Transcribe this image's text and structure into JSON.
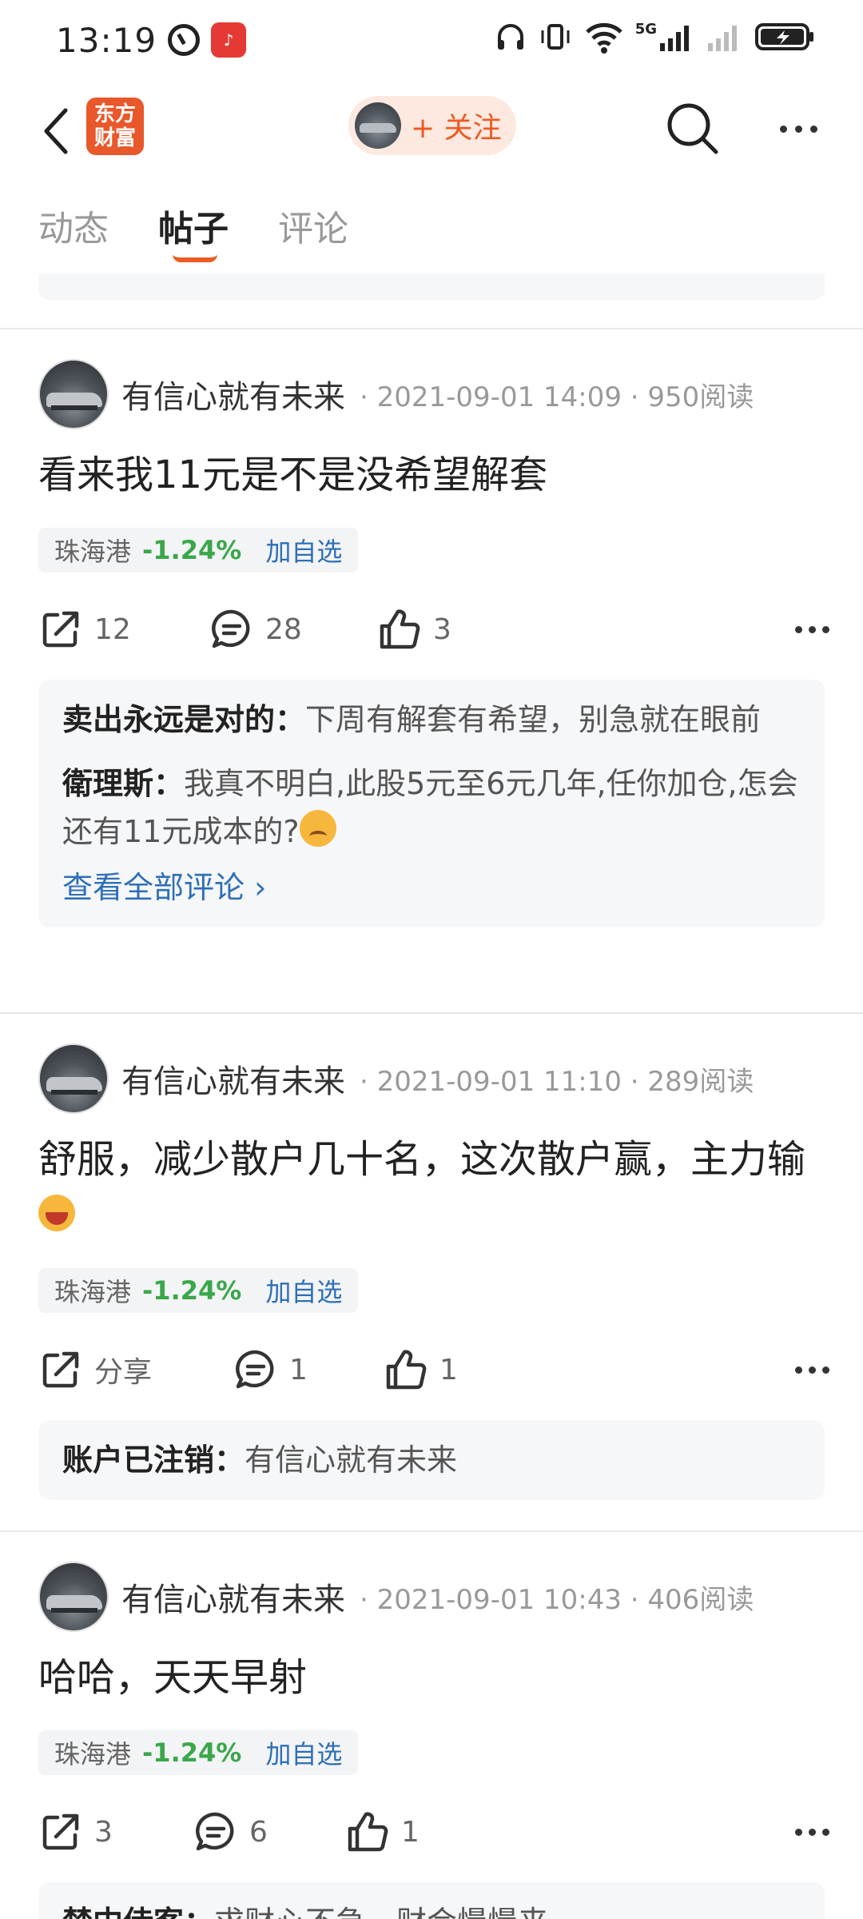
{
  "status_bar": {
    "time": "13:19",
    "signal_label": "5G",
    "wifi_label": "6"
  },
  "header": {
    "logo_text_line1": "东方",
    "logo_text_line2": "财富",
    "follow_label": "+ 关注"
  },
  "tabs": [
    {
      "label": "动态",
      "active": false
    },
    {
      "label": "帖子",
      "active": true
    },
    {
      "label": "评论",
      "active": false
    }
  ],
  "colors": {
    "accent": "#ee5a24",
    "stock_down": "#3aa74a",
    "link": "#2f6fb6"
  },
  "posts": [
    {
      "author": "有信心就有未来",
      "meta": "· 2021-09-01 14:09 · 950阅读",
      "title": "看来我11元是不是没希望解套",
      "stock": {
        "name": "珠海港",
        "change": "-1.24%",
        "add_label": "加自选"
      },
      "actions": {
        "share": "12",
        "comment": "28",
        "like": "3"
      },
      "comments": [
        {
          "user": "卖出永远是对的：",
          "text": "下周有解套有希望，别急就在眼前"
        },
        {
          "user": "衛理斯：",
          "text": "我真不明白,此股5元至6元几年,任你加仓,怎会还有11元成本的?"
        }
      ],
      "view_all": "查看全部评论 ›"
    },
    {
      "author": "有信心就有未来",
      "meta": "· 2021-09-01 11:10 · 289阅读",
      "title": "舒服，减少散户几十名，这次散户赢，主力输",
      "stock": {
        "name": "珠海港",
        "change": "-1.24%",
        "add_label": "加自选"
      },
      "actions": {
        "share": "分享",
        "comment": "1",
        "like": "1"
      },
      "comments": [
        {
          "user": "账户已注销：",
          "text": "有信心就有未来"
        }
      ]
    },
    {
      "author": "有信心就有未来",
      "meta": "· 2021-09-01 10:43 · 406阅读",
      "title": "哈哈，天天早射",
      "stock": {
        "name": "珠海港",
        "change": "-1.24%",
        "add_label": "加自选"
      },
      "actions": {
        "share": "3",
        "comment": "6",
        "like": "1"
      },
      "comments": [
        {
          "user": "禁中侍客：",
          "text": "求财心不急，财会慢慢来"
        }
      ]
    }
  ]
}
